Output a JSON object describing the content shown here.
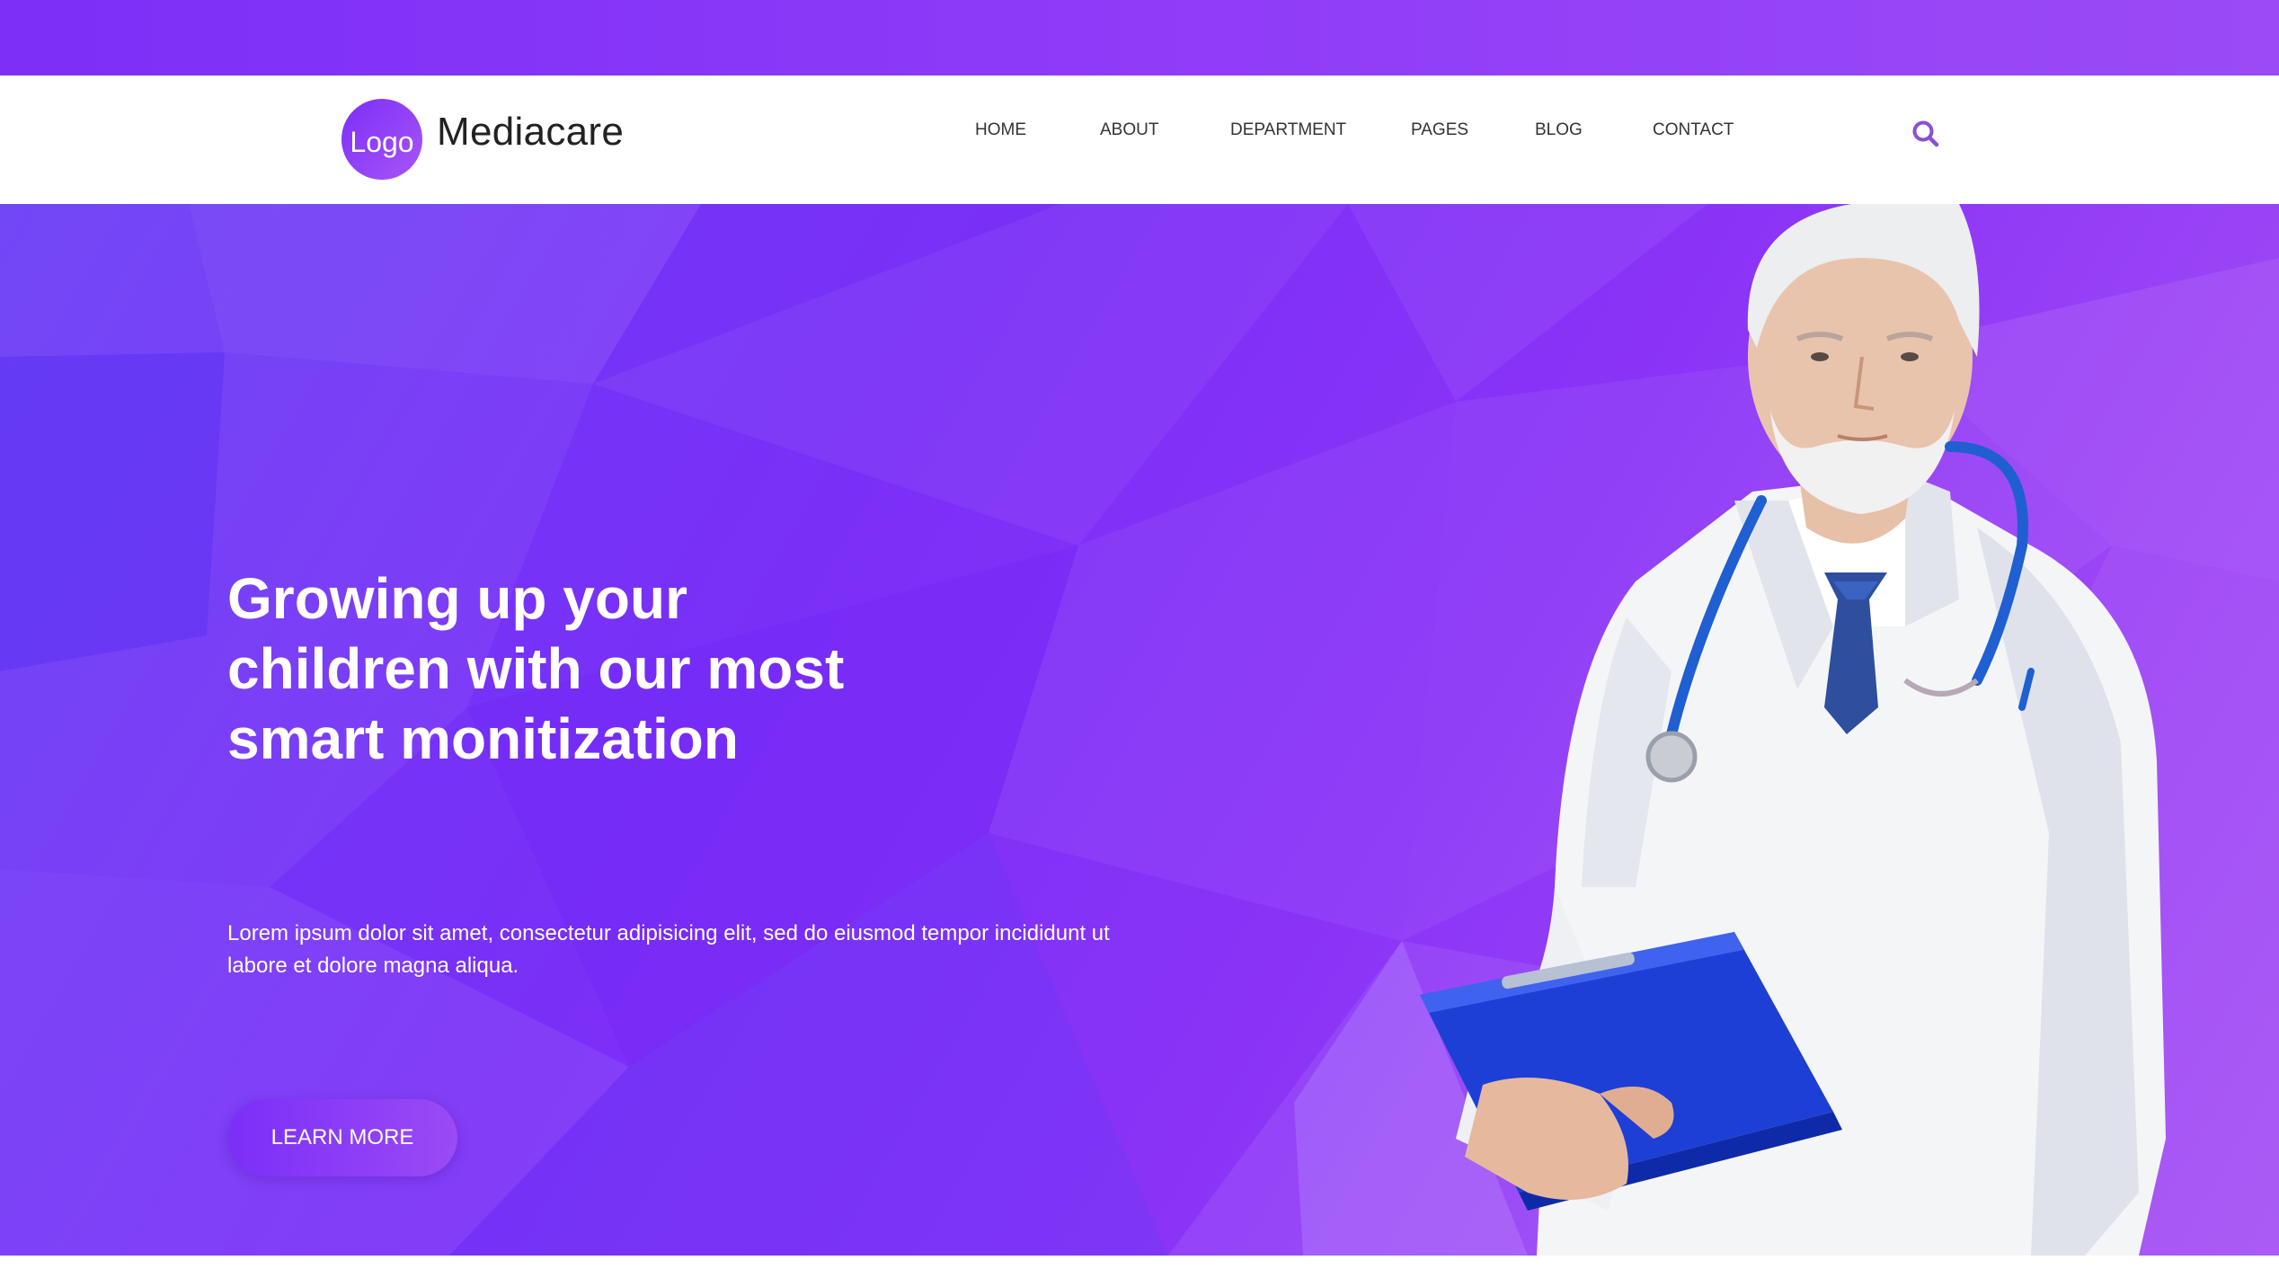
{
  "header": {
    "logo_text": "Logo",
    "brand": "Mediacare",
    "nav": [
      {
        "label": "HOME"
      },
      {
        "label": "ABOUT"
      },
      {
        "label": "DEPARTMENT"
      },
      {
        "label": "PAGES"
      },
      {
        "label": "BLOG"
      },
      {
        "label": "CONTACT"
      }
    ],
    "search_icon": "search-icon"
  },
  "hero": {
    "title_lines": [
      "Growing up your",
      "children with our most",
      "smart monitization"
    ],
    "description": "Lorem ipsum dolor sit amet, consectetur adipisicing elit, sed do eiusmod tempor incididunt ut labore et dolore magna aliqua.",
    "cta_label": "LEARN MORE"
  },
  "colors": {
    "accent": "#7b2ff7",
    "accent_light": "#a855f7",
    "text_dark": "#222222",
    "white": "#ffffff"
  }
}
